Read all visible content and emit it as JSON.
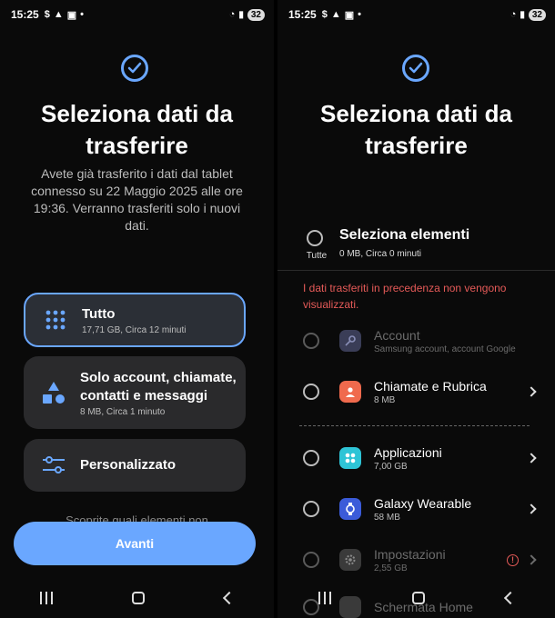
{
  "left": {
    "status": {
      "time": "15:25",
      "battery": "32"
    },
    "title_line1": "Seleziona dati da",
    "title_line2": "trasferire",
    "subtitle": "Avete già trasferito i dati dal tablet connesso su 22 Maggio 2025 alle ore 19:36. Verranno trasferiti solo i nuovi dati.",
    "options": [
      {
        "label": "Tutto",
        "sub": "17,71 GB, Circa 12 minuti",
        "icon": "grid-dots-icon",
        "selected": true
      },
      {
        "label": "Solo account, chiamate, contatti e messaggi",
        "sub": "8 MB, Circa 1 minuto",
        "icon": "shapes-icon",
        "selected": false
      },
      {
        "label": "Personalizzato",
        "sub": "",
        "icon": "sliders-icon",
        "selected": false
      }
    ],
    "hint": "Scoprite quali elementi non",
    "button": "Avanti"
  },
  "right": {
    "status": {
      "time": "15:25",
      "battery": "32"
    },
    "title_line1": "Seleziona dati da",
    "title_line2": "trasferire",
    "select_all": {
      "label": "Seleziona elementi",
      "sub": "0 MB, Circa 0 minuti",
      "radio_label": "Tutte"
    },
    "warning": "I dati trasferiti in precedenza non vengono visualizzati.",
    "items": [
      {
        "name": "Account",
        "detail": "Samsung account, account Google",
        "icon": "key-icon",
        "color": "#4a4f7a"
      },
      {
        "name": "Chiamate e Rubrica",
        "detail": "8 MB",
        "icon": "contact-icon",
        "color": "#f06a4d"
      },
      {
        "name": "Applicazioni",
        "detail": "7,00 GB",
        "icon": "apps-icon",
        "color": "#2ec4d6"
      },
      {
        "name": "Galaxy Wearable",
        "detail": "58 MB",
        "icon": "watch-icon",
        "color": "#3b5bd9"
      },
      {
        "name": "Impostazioni",
        "detail": "2,55 GB",
        "icon": "settings-icon",
        "color": "#555"
      },
      {
        "name": "Schermata Home",
        "detail": "",
        "icon": "home-screen-icon",
        "color": "#555"
      }
    ]
  },
  "colors": {
    "accent": "#6aa7ff",
    "warning": "#e55a58"
  }
}
